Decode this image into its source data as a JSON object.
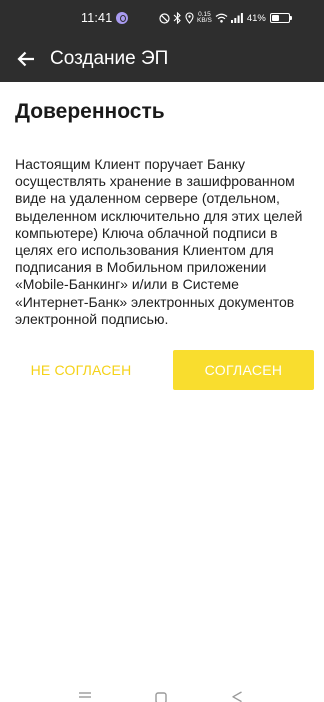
{
  "status_bar": {
    "time": "11:41",
    "speed_value": "0.15",
    "speed_unit": "KB/S",
    "battery_percent": "41%",
    "battery_level": 0.41
  },
  "app_bar": {
    "title": "Создание ЭП",
    "back_icon": "arrow-left-icon"
  },
  "content": {
    "heading": "Доверенность",
    "body": "Настоящим Клиент поручает Банку осуществлять хранение в зашифрованном виде на удаленном сервере (отдельном, выделенном исключительно для этих целей компьютере) Ключа облачной подписи в целях его использования Клиентом для подписания в Мобильном приложении «Mobile-Банкинг» и/или в Системе «Интернет-Банк» электронных документов электронной подписью."
  },
  "actions": {
    "disagree_label": "НЕ СОГЛАСЕН",
    "agree_label": "СОГЛАСЕН"
  },
  "colors": {
    "bar_background": "#2e2e2e",
    "accent_yellow": "#f9dd2e",
    "secondary_text_yellow": "#f5d218"
  },
  "nav_bar": {
    "icons": [
      "menu-icon",
      "home-square-icon",
      "back-triangle-icon"
    ]
  }
}
